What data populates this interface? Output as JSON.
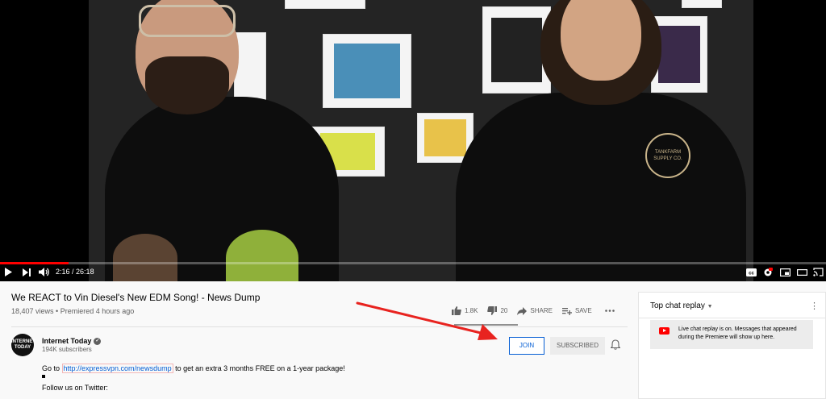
{
  "player": {
    "current_time": "2:16",
    "total_time": "26:18",
    "time_separator": " / ",
    "progress_fraction": 0.083
  },
  "video": {
    "title": "We REACT to Vin Diesel's New EDM Song! - News Dump",
    "views": "18,407 views",
    "separator": " • ",
    "premiered": "Premiered 4 hours ago"
  },
  "actions": {
    "likes": "1.8K",
    "dislikes": "20",
    "share": "SHARE",
    "save": "SAVE"
  },
  "channel": {
    "name": "Internet Today",
    "subscribers": "194K subscribers",
    "avatar_text": "INTERNET TODAY",
    "join_label": "JOIN",
    "subscribed_label": "SUBSCRIBED"
  },
  "description": {
    "prefix": "Go to ",
    "link": "http://expressvpn.com/newsdump",
    "suffix": " to get an extra 3 months FREE on a 1-year package!",
    "line2": "Follow us on Twitter:"
  },
  "chat": {
    "title": "Top chat replay",
    "message": "Live chat replay is on. Messages that appeared during the Premiere will show up here."
  },
  "colors": {
    "accent_blue": "#065fd4",
    "progress_red": "#ff0000",
    "annotation_arrow": "#e8231f"
  },
  "video_frame": {
    "shirt_text": "TANKFARM SUPPLY CO."
  }
}
